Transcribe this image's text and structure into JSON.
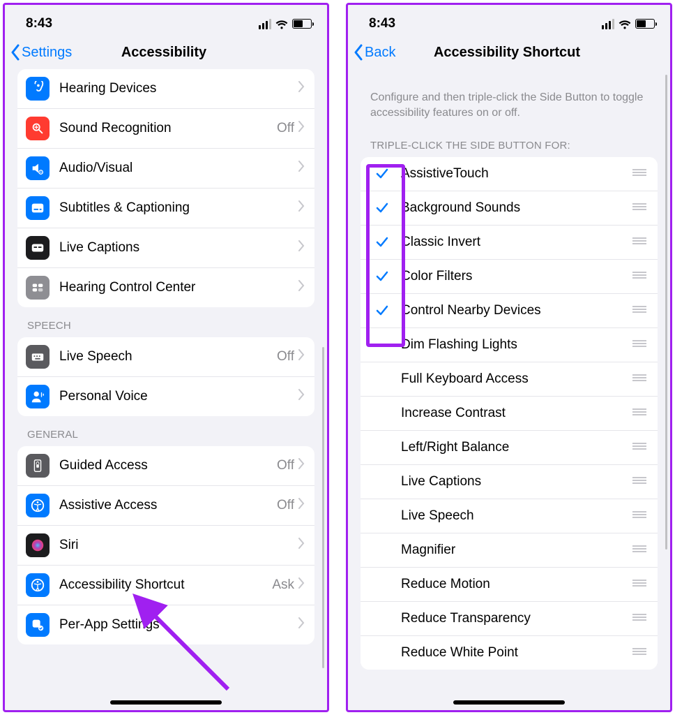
{
  "status": {
    "time": "8:43"
  },
  "left": {
    "back_label": "Settings",
    "title": "Accessibility",
    "groups": [
      {
        "header": null,
        "items": [
          {
            "icon": "ear-icon",
            "bg": "bg-blue",
            "label": "Hearing Devices",
            "value": ""
          },
          {
            "icon": "sound-recognition-icon",
            "bg": "bg-red",
            "label": "Sound Recognition",
            "value": "Off"
          },
          {
            "icon": "audio-visual-icon",
            "bg": "bg-blue",
            "label": "Audio/Visual",
            "value": ""
          },
          {
            "icon": "subtitles-icon",
            "bg": "bg-blue",
            "label": "Subtitles & Captioning",
            "value": ""
          },
          {
            "icon": "live-captions-icon",
            "bg": "bg-black",
            "label": "Live Captions",
            "value": ""
          },
          {
            "icon": "hearing-control-icon",
            "bg": "bg-gray",
            "label": "Hearing Control Center",
            "value": ""
          }
        ]
      },
      {
        "header": "SPEECH",
        "items": [
          {
            "icon": "keyboard-icon",
            "bg": "bg-darkgray",
            "label": "Live Speech",
            "value": "Off"
          },
          {
            "icon": "personal-voice-icon",
            "bg": "bg-blue",
            "label": "Personal Voice",
            "value": ""
          }
        ]
      },
      {
        "header": "GENERAL",
        "items": [
          {
            "icon": "guided-access-icon",
            "bg": "bg-darkgray",
            "label": "Guided Access",
            "value": "Off"
          },
          {
            "icon": "assistive-access-icon",
            "bg": "bg-blue",
            "label": "Assistive Access",
            "value": "Off"
          },
          {
            "icon": "siri-icon",
            "bg": "bg-black",
            "label": "Siri",
            "value": ""
          },
          {
            "icon": "accessibility-icon",
            "bg": "bg-blue",
            "label": "Accessibility Shortcut",
            "value": "Ask"
          },
          {
            "icon": "per-app-icon",
            "bg": "bg-blue",
            "label": "Per-App Settings",
            "value": ""
          }
        ]
      }
    ]
  },
  "right": {
    "back_label": "Back",
    "title": "Accessibility Shortcut",
    "description": "Configure and then triple-click the Side Button to toggle accessibility features on or off.",
    "header": "TRIPLE-CLICK THE SIDE BUTTON FOR:",
    "items": [
      {
        "label": "AssistiveTouch",
        "checked": true
      },
      {
        "label": "Background Sounds",
        "checked": true
      },
      {
        "label": "Classic Invert",
        "checked": true
      },
      {
        "label": "Color Filters",
        "checked": true
      },
      {
        "label": "Control Nearby Devices",
        "checked": true
      },
      {
        "label": "Dim Flashing Lights",
        "checked": false
      },
      {
        "label": "Full Keyboard Access",
        "checked": false
      },
      {
        "label": "Increase Contrast",
        "checked": false
      },
      {
        "label": "Left/Right Balance",
        "checked": false
      },
      {
        "label": "Live Captions",
        "checked": false
      },
      {
        "label": "Live Speech",
        "checked": false
      },
      {
        "label": "Magnifier",
        "checked": false
      },
      {
        "label": "Reduce Motion",
        "checked": false
      },
      {
        "label": "Reduce Transparency",
        "checked": false
      },
      {
        "label": "Reduce White Point",
        "checked": false
      }
    ]
  }
}
